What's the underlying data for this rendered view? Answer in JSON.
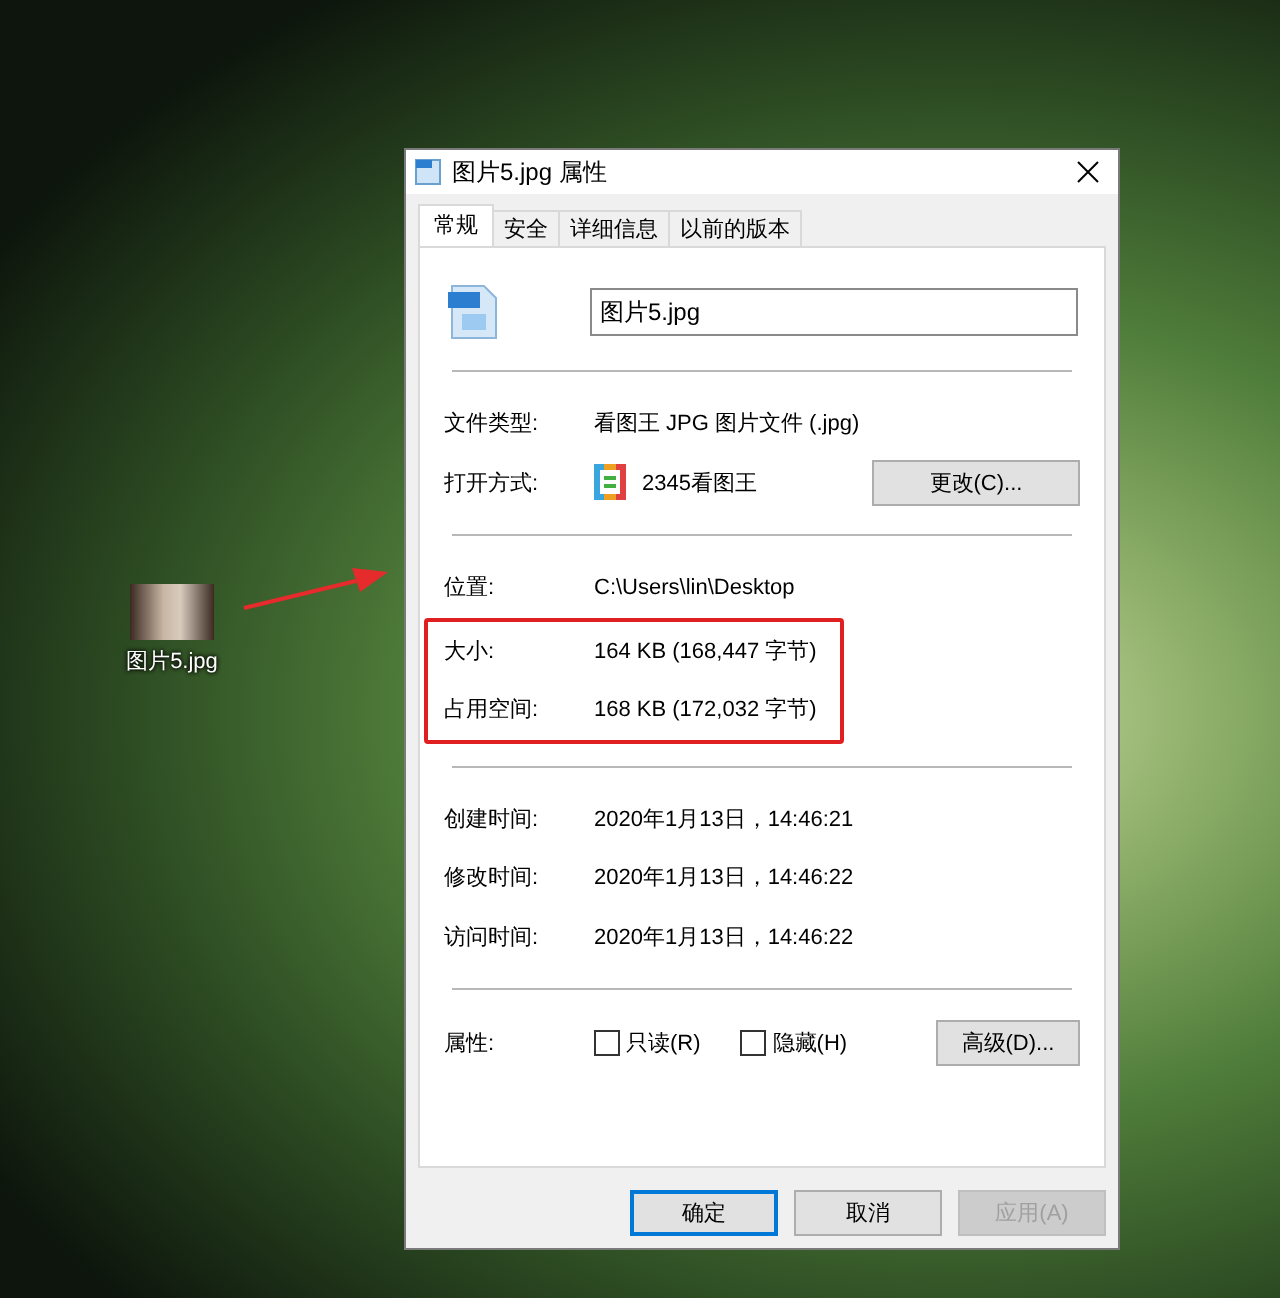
{
  "desktop_icon": {
    "label": "图片5.jpg"
  },
  "window": {
    "title": "图片5.jpg 属性"
  },
  "tabs": [
    {
      "label": "常规",
      "selected": true
    },
    {
      "label": "安全",
      "selected": false
    },
    {
      "label": "详细信息",
      "selected": false
    },
    {
      "label": "以前的版本",
      "selected": false
    }
  ],
  "file_name": {
    "value": "图片5.jpg"
  },
  "sections": [
    {
      "blocks": [
        {
          "highlighted": false,
          "rows": [
            {
              "kind": "text",
              "label": "文件类型:",
              "value": "看图王 JPG 图片文件 (.jpg)"
            },
            {
              "kind": "app",
              "label": "打开方式:",
              "value": "2345看图王",
              "button": "更改(C)..."
            }
          ]
        }
      ]
    },
    {
      "blocks": [
        {
          "highlighted": false,
          "rows": [
            {
              "kind": "text",
              "label": "位置:",
              "value": "C:\\Users\\lin\\Desktop"
            }
          ]
        },
        {
          "highlighted": true,
          "rows": [
            {
              "kind": "text",
              "label": "大小:",
              "value": "164 KB (168,447 字节)"
            },
            {
              "kind": "text",
              "label": "占用空间:",
              "value": "168 KB (172,032 字节)"
            }
          ]
        }
      ]
    },
    {
      "blocks": [
        {
          "highlighted": false,
          "rows": [
            {
              "kind": "text",
              "label": "创建时间:",
              "value": "2020年1月13日，14:46:21"
            },
            {
              "kind": "text",
              "label": "修改时间:",
              "value": "2020年1月13日，14:46:22"
            },
            {
              "kind": "text",
              "label": "访问时间:",
              "value": "2020年1月13日，14:46:22"
            }
          ]
        }
      ]
    }
  ],
  "attributes": {
    "label": "属性:",
    "checkboxes": [
      {
        "label": "只读(R)",
        "checked": false
      },
      {
        "label": "隐藏(H)",
        "checked": false
      }
    ],
    "button": "高级(D)..."
  },
  "buttons": [
    {
      "label": "确定",
      "kind": "default",
      "disabled": false
    },
    {
      "label": "取消",
      "kind": "normal",
      "disabled": false
    },
    {
      "label": "应用(A)",
      "kind": "normal",
      "disabled": true
    }
  ]
}
